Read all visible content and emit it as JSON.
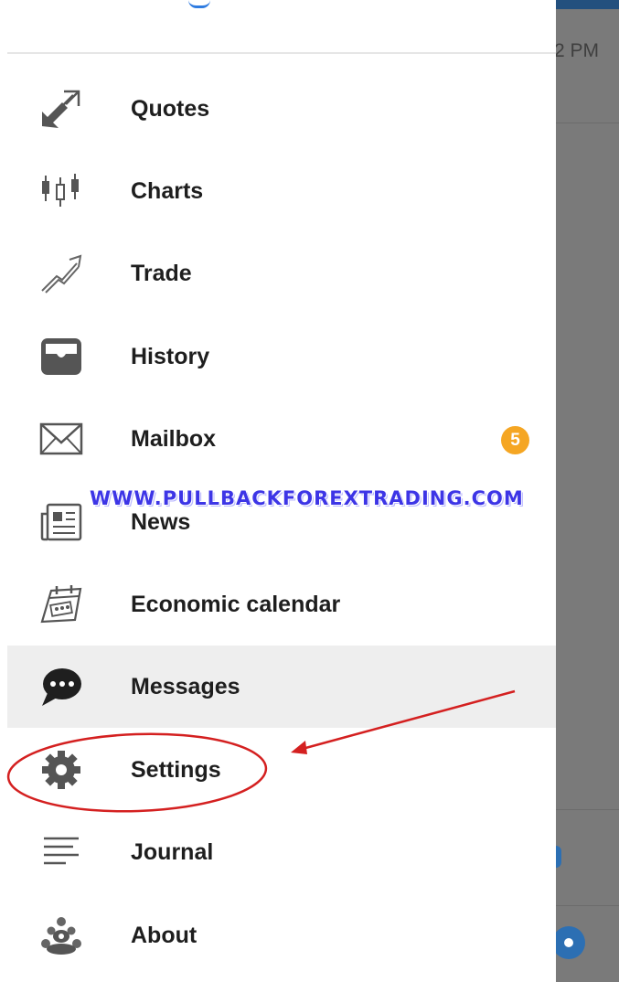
{
  "background_app": {
    "time_partial": "2 PM"
  },
  "colors": {
    "badge": "#f5a623",
    "active_row": "#eeeeee",
    "annotation": "#d42020",
    "watermark": "#3d35e6",
    "overlay": "#7a7a7a"
  },
  "menu": {
    "items": [
      {
        "label": "Quotes",
        "icon": "quotes-arrows-icon"
      },
      {
        "label": "Charts",
        "icon": "candlestick-chart-icon"
      },
      {
        "label": "Trade",
        "icon": "trade-trend-icon"
      },
      {
        "label": "History",
        "icon": "inbox-tray-icon"
      },
      {
        "label": "Mailbox",
        "icon": "envelope-icon",
        "badge": "5"
      },
      {
        "label": "News",
        "icon": "newspaper-icon"
      },
      {
        "label": "Economic calendar",
        "icon": "calendar-icon"
      },
      {
        "label": "Messages",
        "icon": "chat-bubble-icon",
        "selected": true
      },
      {
        "label": "Settings",
        "icon": "gear-icon",
        "highlighted": true
      },
      {
        "label": "Journal",
        "icon": "lines-journal-icon"
      },
      {
        "label": "About",
        "icon": "about-logo-icon"
      }
    ]
  },
  "watermark": "WWW.PULLBACKFOREXTRADING.COM"
}
